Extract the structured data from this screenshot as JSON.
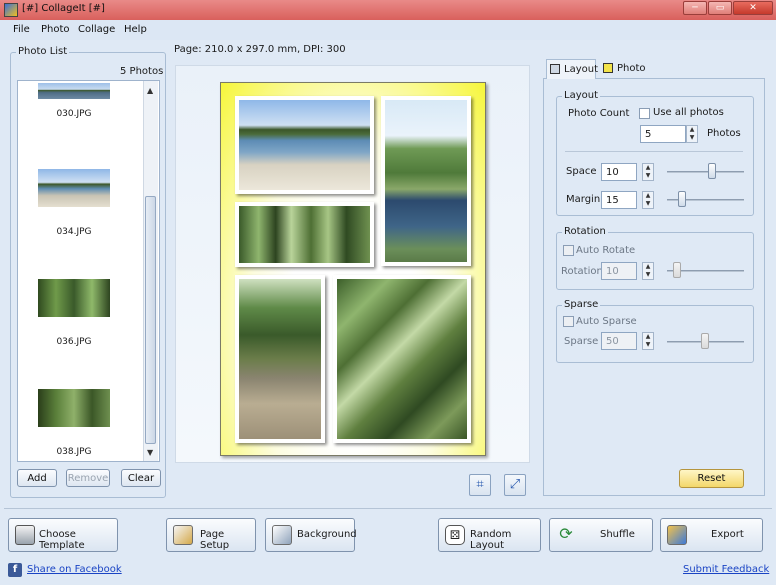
{
  "window": {
    "title": "[#] CollageIt [#]",
    "controls": [
      "─",
      "▭",
      "✕"
    ]
  },
  "menu": [
    "File",
    "Photo",
    "Collage",
    "Help"
  ],
  "photo_list": {
    "label": "Photo List",
    "count": "5 Photos",
    "items": [
      {
        "name": "030.JPG"
      },
      {
        "name": "034.JPG"
      },
      {
        "name": "036.JPG"
      },
      {
        "name": "038.JPG"
      }
    ],
    "buttons": {
      "add": "Add",
      "remove": "Remove",
      "clear": "Clear"
    }
  },
  "page_info": "Page: 210.0 x 297.0 mm, DPI: 300",
  "tabs": {
    "layout": "Layout",
    "photo": "Photo"
  },
  "layout": {
    "group": "Layout",
    "photo_count_label": "Photo Count",
    "use_all_label": "Use all photos",
    "photo_count_value": "5",
    "photos_unit": "Photos",
    "space_label": "Space",
    "space_value": "10",
    "margin_label": "Margin",
    "margin_value": "15"
  },
  "rotation": {
    "group": "Rotation",
    "auto_label": "Auto Rotate",
    "label": "Rotation",
    "value": "10"
  },
  "sparse": {
    "group": "Sparse",
    "auto_label": "Auto Sparse",
    "label": "Sparse",
    "value": "50"
  },
  "reset_label": "Reset",
  "bottom": {
    "choose_template": "Choose Template",
    "page_setup": "Page Setup",
    "background": "Background",
    "random_layout": "Random Layout",
    "shuffle": "Shuffle",
    "export": "Export"
  },
  "links": {
    "facebook": "Share on Facebook",
    "feedback": "Submit Feedback"
  },
  "colors": {
    "page_border_glow": "#f6f63a",
    "titlebar": "#d9605c",
    "accent_link": "#1a44c4"
  }
}
